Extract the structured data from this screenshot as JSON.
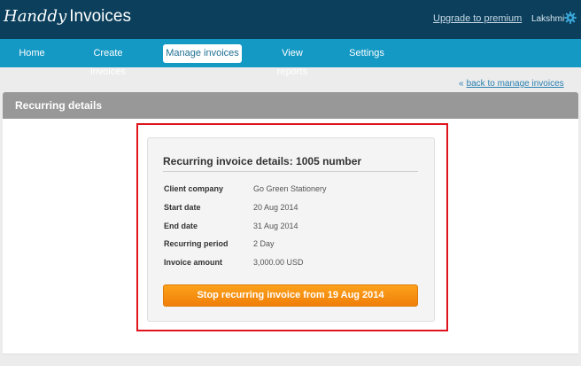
{
  "header": {
    "logo_script": "Handdy",
    "logo_text": "Invoices",
    "upgrade_link": "Upgrade to premium",
    "user_name": "Lakshmi",
    "settings_icon": "gear-icon"
  },
  "nav": {
    "items": [
      {
        "label": "Home",
        "active": false
      },
      {
        "label": "Create invoices",
        "active": false
      },
      {
        "label": "Manage invoices",
        "active": true
      },
      {
        "label": "View reports",
        "active": false
      },
      {
        "label": "Settings",
        "active": false
      }
    ]
  },
  "back_link": {
    "icon": "double-chevron-left-icon",
    "label": "back to manage invoices"
  },
  "section": {
    "title": "Recurring details"
  },
  "details": {
    "title": "Recurring invoice details: 1005 number",
    "rows": [
      {
        "label": "Client company",
        "value": "Go Green Stationery"
      },
      {
        "label": "Start date",
        "value": "20 Aug 2014"
      },
      {
        "label": "End date",
        "value": "31 Aug 2014"
      },
      {
        "label": "Recurring period",
        "value": "2 Day"
      },
      {
        "label": "Invoice amount",
        "value": "3,000.00 USD"
      }
    ],
    "stop_button": "Stop recurring invoice from 19 Aug 2014"
  },
  "colors": {
    "header_bg": "#0b3f5c",
    "nav_bg": "#1498c4",
    "section_bar": "#989898",
    "button_orange": "#f7901a",
    "highlight_red": "#e0141c",
    "link_blue": "#2a7fb0"
  }
}
